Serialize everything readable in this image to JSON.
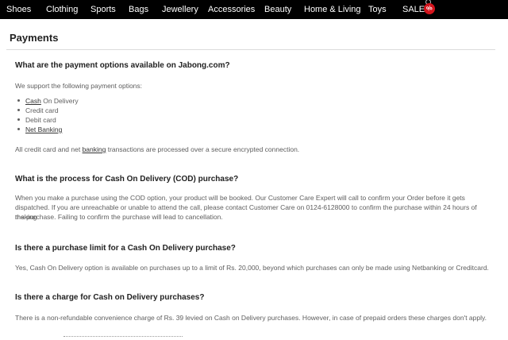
{
  "nav": {
    "items": [
      "Shoes",
      "Clothing",
      "Sports",
      "Bags",
      "Jewellery",
      "Accessories",
      "Beauty",
      "Home & Living",
      "Toys",
      "SALE"
    ],
    "sale_badge": "%",
    "bg_color": "#000000",
    "sale_color": "#d4141c"
  },
  "page": {
    "title": "Payments"
  },
  "sections": [
    {
      "question": "What are the payment options available on Jabong.com?",
      "intro": "We support the following payment options:",
      "options": [
        {
          "lead": "Cash",
          "rest": " On Delivery"
        },
        {
          "lead": "",
          "rest": "Credit card"
        },
        {
          "lead": "",
          "rest": "Debit card"
        },
        {
          "lead": "Net Banking",
          "rest": ""
        }
      ],
      "note_before": "All credit card and net ",
      "note_link": "banking",
      "note_after": " transactions are processed over a secure encrypted connection."
    },
    {
      "question": "What is the process for Cash On Delivery (COD) purchase?",
      "lines": [
        "When you make a purchase using the COD option, your product will be booked. Our Customer Care Expert will call to confirm your Order before it gets",
        "dispatched. If you are unreachable or unable to attend the call, please contact Customer Care on 0124-6128000 to confirm the purchase within 24 hours of making",
        "the purchase. Failing to confirm the purchase will lead to cancellation."
      ]
    },
    {
      "question": "Is there a purchase limit for a Cash On Delivery purchase?",
      "lines": [
        "Yes, Cash On Delivery option is available on purchases up to a limit of Rs. 20,000, beyond which purchases can only be made using Netbanking or Creditcard."
      ]
    },
    {
      "question": "Is there a charge for Cash on Delivery purchases?",
      "lines": [
        "There is a non-refundable convenience charge of Rs. 39 levied on Cash on Delivery purchases. However, in case of prepaid orders these charges don't apply."
      ]
    }
  ]
}
